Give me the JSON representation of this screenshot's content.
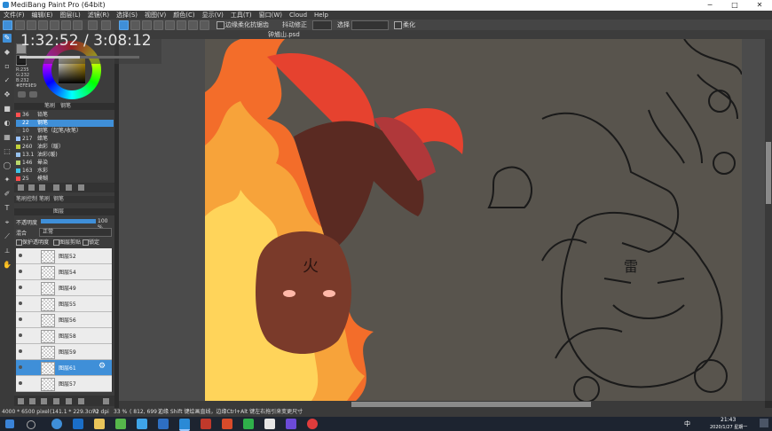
{
  "window": {
    "title": "MediBang Paint Pro (64bit)"
  },
  "menu": [
    "文件(F)",
    "编辑(E)",
    "图层(L)",
    "滤镜(R)",
    "选择(S)",
    "视图(V)",
    "颜色(C)",
    "显示(V)",
    "工具(T)",
    "窗口(W)",
    "Cloud",
    "Help"
  ],
  "toolbar": {
    "antialias_label": "边缘柔化抗锯齿",
    "stroke_correct_label": "抖动修正",
    "select_label": "选择",
    "select_value": "",
    "soft_label": "柔化"
  },
  "tab": {
    "filename": "钟馗山.psd"
  },
  "timer": {
    "text": "1:32:52 / 3:08:12"
  },
  "color": {
    "r": "R:235",
    "g": "G:232",
    "b": "B:232",
    "hex": "#EFE9E9"
  },
  "brush_panel": {
    "tabs": [
      "笔刷",
      "钢笔"
    ],
    "items": [
      {
        "num": "36",
        "name": "铅笔",
        "color": "#ff5050"
      },
      {
        "num": "22",
        "name": "钢笔",
        "color": "#3f8fd8",
        "selected": true
      },
      {
        "num": "10",
        "name": "钢笔（起笔/收笔）",
        "color": "#444444"
      },
      {
        "num": "217",
        "name": "蜡笔",
        "color": "#99c2ff"
      },
      {
        "num": "260",
        "name": "油彩（暖）",
        "color": "#c3d23a"
      },
      {
        "num": "13.1",
        "name": "油彩(暖)",
        "color": "#97c2ef"
      },
      {
        "num": "146",
        "name": "晕染",
        "color": "#b9d86b"
      },
      {
        "num": "163",
        "name": "水彩",
        "color": "#3fc4e8"
      },
      {
        "num": "25",
        "name": "模糊",
        "color": "#ff4c4c"
      }
    ],
    "footer_tabs": [
      "笔刷控制",
      "笔刷",
      "钢笔"
    ]
  },
  "layer_panel": {
    "title": "图层",
    "opacity_label": "不透明度",
    "opacity_value": "100 %",
    "blend_label": "混合",
    "blend_value": "正常",
    "protect_label": "保护透明度",
    "clip_label": "图层剪贴",
    "lock_label": "锁定",
    "layers": [
      {
        "name": "图层52",
        "selected": false
      },
      {
        "name": "图层54",
        "selected": false
      },
      {
        "name": "图层49",
        "selected": false
      },
      {
        "name": "图层55",
        "selected": false
      },
      {
        "name": "图层56",
        "selected": false
      },
      {
        "name": "图层58",
        "selected": false
      },
      {
        "name": "图层59",
        "selected": false
      },
      {
        "name": "图层61",
        "selected": true
      },
      {
        "name": "图层57",
        "selected": false
      }
    ]
  },
  "canvas": {
    "glyph_left": "火",
    "glyph_right": "雷"
  },
  "statusbar": {
    "size": "4000 * 6500 pixel",
    "dims": "(141.1 * 229.3cm)",
    "dpi": "72 dpi",
    "zoom": "33 %",
    "coords": "( 812, 699 )",
    "hint": "边缘 Shift 键绘画直线，边缘Ctrl+Alt 键左右拖引来变更尺寸"
  },
  "taskbar": {
    "time": "21:43",
    "date": "2020/1/27 星期一",
    "ime": "中"
  },
  "colors": {
    "accent": "#3f8fd8"
  }
}
